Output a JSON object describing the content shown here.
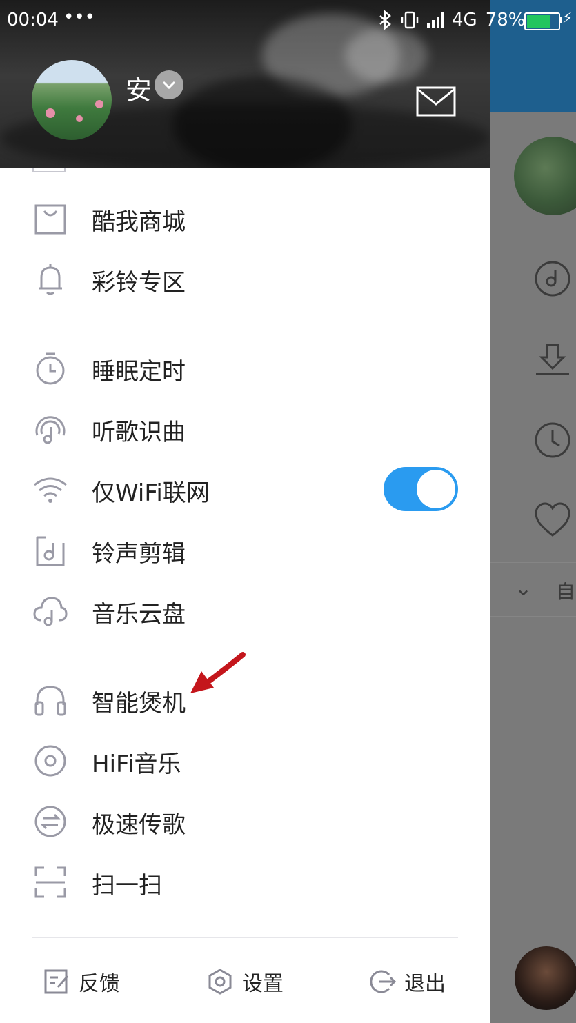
{
  "status_bar": {
    "time": "00:04",
    "dots": "•••",
    "network": "4G",
    "battery": "78%",
    "battery_level": 0.78
  },
  "user": {
    "name": "安"
  },
  "menu": {
    "items": [
      {
        "label": "酷我商城",
        "icon": "shopping-bag-icon"
      },
      {
        "label": "彩铃专区",
        "icon": "bell-icon"
      },
      {
        "label": "睡眠定时",
        "icon": "timer-icon"
      },
      {
        "label": "听歌识曲",
        "icon": "music-recognition-icon"
      },
      {
        "label": "仅WiFi联网",
        "icon": "wifi-icon"
      },
      {
        "label": "铃声剪辑",
        "icon": "ringtone-edit-icon"
      },
      {
        "label": "音乐云盘",
        "icon": "cloud-music-icon"
      },
      {
        "label": "智能煲机",
        "icon": "headphones-icon"
      },
      {
        "label": "HiFi音乐",
        "icon": "hifi-disc-icon"
      },
      {
        "label": "极速传歌",
        "icon": "transfer-icon"
      },
      {
        "label": "扫一扫",
        "icon": "scan-icon"
      }
    ],
    "wifi_only_on": true
  },
  "footer": {
    "feedback": "反馈",
    "settings": "设置",
    "logout": "退出"
  },
  "background_app": {
    "expand_text": "自"
  },
  "colors": {
    "accent": "#2a9bf0",
    "header_bar": "#1e5f8e",
    "annotation_arrow": "#c4161c",
    "icon_gray": "#9a9aa6"
  }
}
